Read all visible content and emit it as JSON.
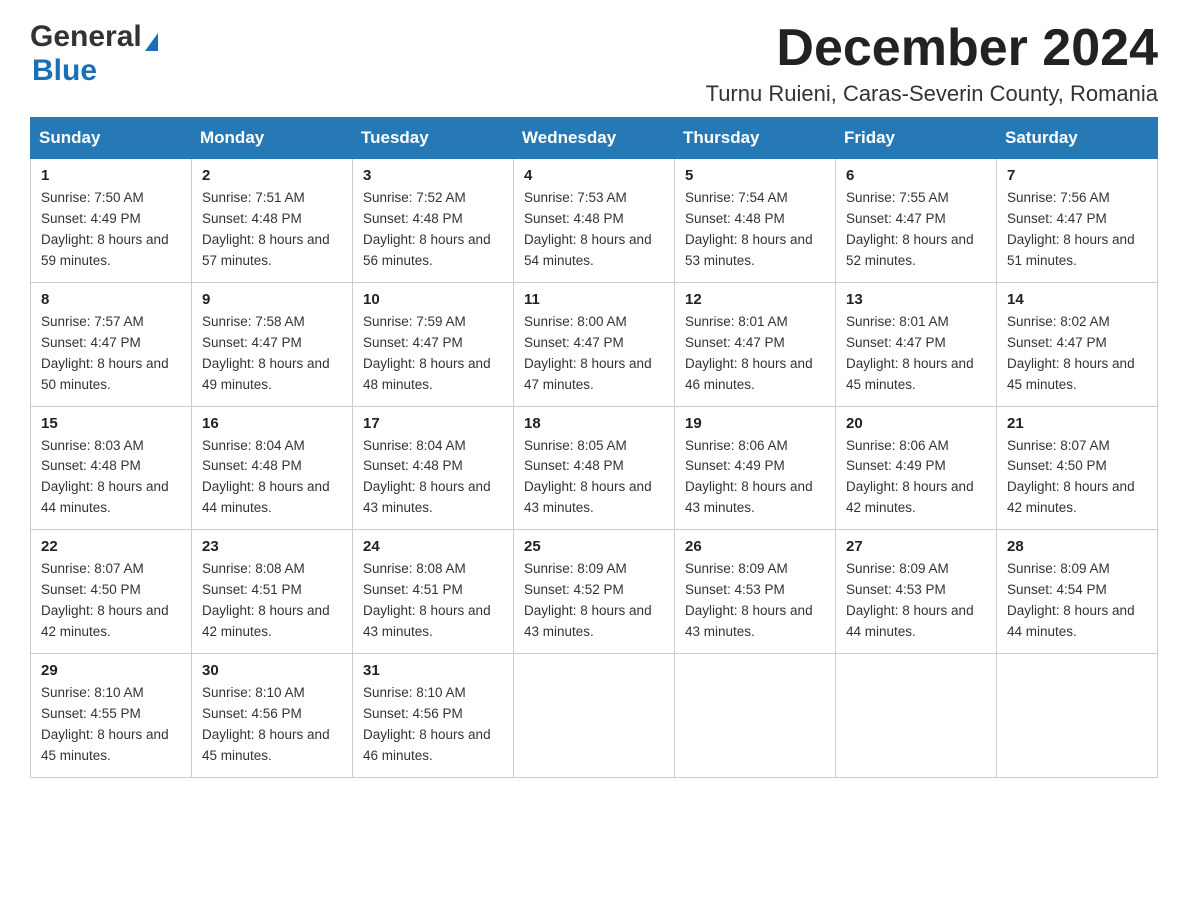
{
  "header": {
    "logo_general": "General",
    "logo_blue": "Blue",
    "month_title": "December 2024",
    "subtitle": "Turnu Ruieni, Caras-Severin County, Romania"
  },
  "days_of_week": [
    "Sunday",
    "Monday",
    "Tuesday",
    "Wednesday",
    "Thursday",
    "Friday",
    "Saturday"
  ],
  "weeks": [
    [
      {
        "day": "1",
        "sunrise": "7:50 AM",
        "sunset": "4:49 PM",
        "daylight": "8 hours and 59 minutes."
      },
      {
        "day": "2",
        "sunrise": "7:51 AM",
        "sunset": "4:48 PM",
        "daylight": "8 hours and 57 minutes."
      },
      {
        "day": "3",
        "sunrise": "7:52 AM",
        "sunset": "4:48 PM",
        "daylight": "8 hours and 56 minutes."
      },
      {
        "day": "4",
        "sunrise": "7:53 AM",
        "sunset": "4:48 PM",
        "daylight": "8 hours and 54 minutes."
      },
      {
        "day": "5",
        "sunrise": "7:54 AM",
        "sunset": "4:48 PM",
        "daylight": "8 hours and 53 minutes."
      },
      {
        "day": "6",
        "sunrise": "7:55 AM",
        "sunset": "4:47 PM",
        "daylight": "8 hours and 52 minutes."
      },
      {
        "day": "7",
        "sunrise": "7:56 AM",
        "sunset": "4:47 PM",
        "daylight": "8 hours and 51 minutes."
      }
    ],
    [
      {
        "day": "8",
        "sunrise": "7:57 AM",
        "sunset": "4:47 PM",
        "daylight": "8 hours and 50 minutes."
      },
      {
        "day": "9",
        "sunrise": "7:58 AM",
        "sunset": "4:47 PM",
        "daylight": "8 hours and 49 minutes."
      },
      {
        "day": "10",
        "sunrise": "7:59 AM",
        "sunset": "4:47 PM",
        "daylight": "8 hours and 48 minutes."
      },
      {
        "day": "11",
        "sunrise": "8:00 AM",
        "sunset": "4:47 PM",
        "daylight": "8 hours and 47 minutes."
      },
      {
        "day": "12",
        "sunrise": "8:01 AM",
        "sunset": "4:47 PM",
        "daylight": "8 hours and 46 minutes."
      },
      {
        "day": "13",
        "sunrise": "8:01 AM",
        "sunset": "4:47 PM",
        "daylight": "8 hours and 45 minutes."
      },
      {
        "day": "14",
        "sunrise": "8:02 AM",
        "sunset": "4:47 PM",
        "daylight": "8 hours and 45 minutes."
      }
    ],
    [
      {
        "day": "15",
        "sunrise": "8:03 AM",
        "sunset": "4:48 PM",
        "daylight": "8 hours and 44 minutes."
      },
      {
        "day": "16",
        "sunrise": "8:04 AM",
        "sunset": "4:48 PM",
        "daylight": "8 hours and 44 minutes."
      },
      {
        "day": "17",
        "sunrise": "8:04 AM",
        "sunset": "4:48 PM",
        "daylight": "8 hours and 43 minutes."
      },
      {
        "day": "18",
        "sunrise": "8:05 AM",
        "sunset": "4:48 PM",
        "daylight": "8 hours and 43 minutes."
      },
      {
        "day": "19",
        "sunrise": "8:06 AM",
        "sunset": "4:49 PM",
        "daylight": "8 hours and 43 minutes."
      },
      {
        "day": "20",
        "sunrise": "8:06 AM",
        "sunset": "4:49 PM",
        "daylight": "8 hours and 42 minutes."
      },
      {
        "day": "21",
        "sunrise": "8:07 AM",
        "sunset": "4:50 PM",
        "daylight": "8 hours and 42 minutes."
      }
    ],
    [
      {
        "day": "22",
        "sunrise": "8:07 AM",
        "sunset": "4:50 PM",
        "daylight": "8 hours and 42 minutes."
      },
      {
        "day": "23",
        "sunrise": "8:08 AM",
        "sunset": "4:51 PM",
        "daylight": "8 hours and 42 minutes."
      },
      {
        "day": "24",
        "sunrise": "8:08 AM",
        "sunset": "4:51 PM",
        "daylight": "8 hours and 43 minutes."
      },
      {
        "day": "25",
        "sunrise": "8:09 AM",
        "sunset": "4:52 PM",
        "daylight": "8 hours and 43 minutes."
      },
      {
        "day": "26",
        "sunrise": "8:09 AM",
        "sunset": "4:53 PM",
        "daylight": "8 hours and 43 minutes."
      },
      {
        "day": "27",
        "sunrise": "8:09 AM",
        "sunset": "4:53 PM",
        "daylight": "8 hours and 44 minutes."
      },
      {
        "day": "28",
        "sunrise": "8:09 AM",
        "sunset": "4:54 PM",
        "daylight": "8 hours and 44 minutes."
      }
    ],
    [
      {
        "day": "29",
        "sunrise": "8:10 AM",
        "sunset": "4:55 PM",
        "daylight": "8 hours and 45 minutes."
      },
      {
        "day": "30",
        "sunrise": "8:10 AM",
        "sunset": "4:56 PM",
        "daylight": "8 hours and 45 minutes."
      },
      {
        "day": "31",
        "sunrise": "8:10 AM",
        "sunset": "4:56 PM",
        "daylight": "8 hours and 46 minutes."
      },
      null,
      null,
      null,
      null
    ]
  ]
}
